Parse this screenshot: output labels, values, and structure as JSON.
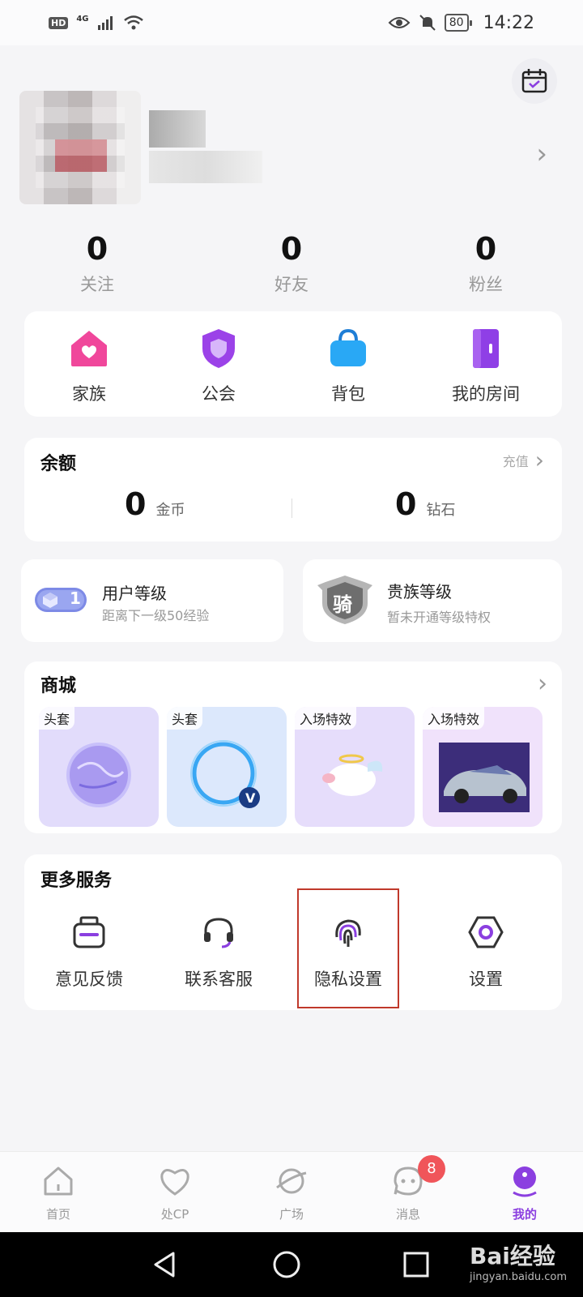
{
  "status_bar": {
    "hd": "HD",
    "network": "4G",
    "battery": "80",
    "time": "14:22"
  },
  "stats": [
    {
      "value": "0",
      "label": "关注"
    },
    {
      "value": "0",
      "label": "好友"
    },
    {
      "value": "0",
      "label": "粉丝"
    }
  ],
  "quick_actions": [
    {
      "label": "家族",
      "icon": "home-heart-icon",
      "color": "#f0479b"
    },
    {
      "label": "公会",
      "icon": "shield-icon",
      "color": "#9b42e8"
    },
    {
      "label": "背包",
      "icon": "bag-icon",
      "color": "#29a8f5"
    },
    {
      "label": "我的房间",
      "icon": "door-icon",
      "color": "#8f3fe6"
    }
  ],
  "balance": {
    "title": "余额",
    "recharge": "充值",
    "gold_value": "0",
    "gold_unit": "金币",
    "diamond_value": "0",
    "diamond_unit": "钻石"
  },
  "user_level": {
    "title": "用户等级",
    "subtitle": "距离下一级50经验",
    "level": "1"
  },
  "noble_level": {
    "title": "贵族等级",
    "subtitle": "暂未开通等级特权",
    "badge_char": "骑"
  },
  "mall": {
    "title": "商城",
    "items": [
      {
        "tag": "头套"
      },
      {
        "tag": "头套"
      },
      {
        "tag": "入场特效"
      },
      {
        "tag": "入场特效"
      }
    ]
  },
  "services": {
    "title": "更多服务",
    "items": [
      {
        "label": "意见反馈",
        "icon": "feedback-icon"
      },
      {
        "label": "联系客服",
        "icon": "headset-icon"
      },
      {
        "label": "隐私设置",
        "icon": "fingerprint-icon"
      },
      {
        "label": "设置",
        "icon": "settings-icon"
      }
    ]
  },
  "tabs": [
    {
      "label": "首页",
      "icon": "home-icon"
    },
    {
      "label": "处CP",
      "icon": "heart-icon"
    },
    {
      "label": "广场",
      "icon": "planet-icon"
    },
    {
      "label": "消息",
      "icon": "message-icon",
      "badge": "8"
    },
    {
      "label": "我的",
      "icon": "profile-icon",
      "active": true
    }
  ],
  "watermark": {
    "brand": "Bai经验",
    "url": "jingyan.baidu.com"
  },
  "colors": {
    "accent": "#8b3fe0",
    "badge": "#f0555a",
    "highlight": "#c0392b"
  }
}
